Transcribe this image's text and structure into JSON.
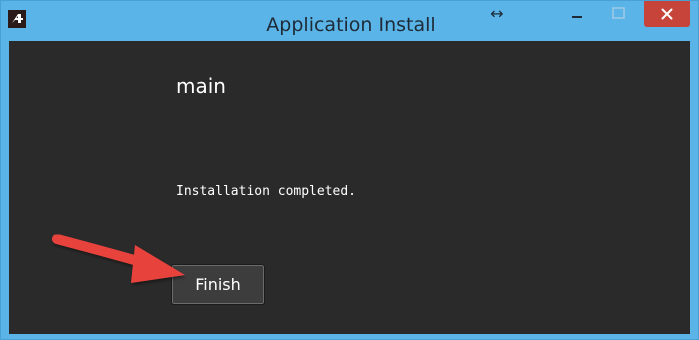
{
  "window": {
    "title": "Application Install",
    "resize_glyph": "↔",
    "icons": {
      "app": "app-logo-icon",
      "minimize": "minimize-icon",
      "maximize": "maximize-icon",
      "close": "close-icon",
      "resize": "resize-horizontal-icon"
    }
  },
  "content": {
    "heading": "main",
    "message": "Installation completed.",
    "finish_label": "Finish"
  },
  "annotation": {
    "arrow_color": "#e8433e",
    "arrow_icon": "pointer-arrow-icon"
  },
  "colors": {
    "titlebar": "#5ab4e8",
    "content_bg": "#2a2a2a",
    "close_button": "#c6443a"
  }
}
